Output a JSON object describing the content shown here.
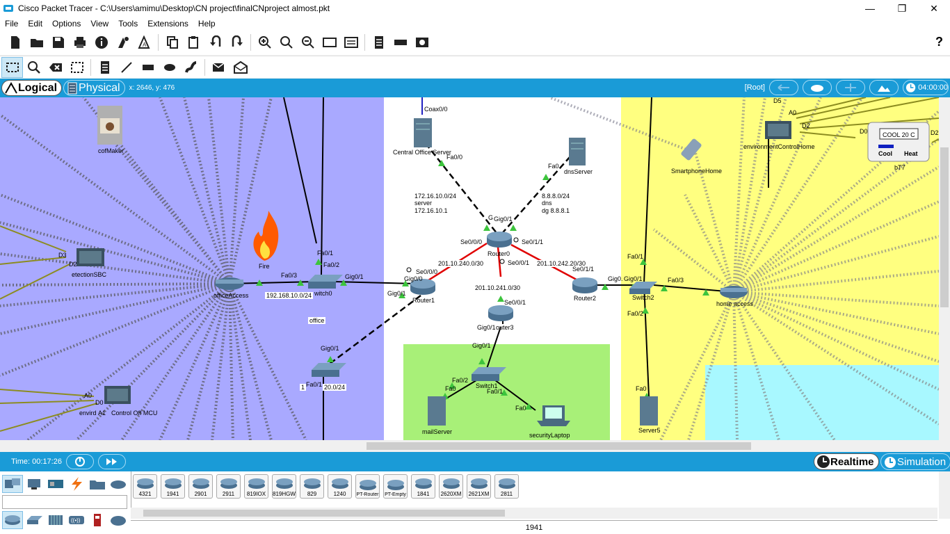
{
  "window": {
    "title": "Cisco Packet Tracer - C:\\Users\\amimu\\Desktop\\CN project\\finalCNproject almost.pkt",
    "minimize": "—",
    "maximize": "❐",
    "close": "✕"
  },
  "menu": [
    "File",
    "Edit",
    "Options",
    "View",
    "Tools",
    "Extensions",
    "Help"
  ],
  "toolbar": {
    "help": "?"
  },
  "modebar": {
    "logical": "Logical",
    "physical": "Physical",
    "coords": "x: 2646, y: 476",
    "root": "[Root]",
    "clock": "04:00:00"
  },
  "canvas": {
    "devices": {
      "cofmaker": "cofMaker",
      "fire": "Fire",
      "detection": "etectionSBC",
      "office_access": "officeAccess",
      "switch0": "witch0",
      "env_office": "envird",
      "control_office": "Control Off MCU",
      "central_server": "Central Office Server",
      "dns_server": "dnsServer",
      "router0": "Router0",
      "router1": "Router1",
      "router2": "Router2",
      "router3": "outer3",
      "switch1": "Switch1",
      "mail_server": "mailServer",
      "security_laptop": "securityLaptop",
      "smartphone": "SmartphoneHome",
      "env_home": "environmentControlHome",
      "thermostat": "bT7",
      "thermo_display": "COOL 20 C",
      "thermo_cool": "Cool",
      "thermo_heat": "Heat",
      "switch2": "Switch2",
      "home_access": "home access",
      "server5": "Server5"
    },
    "labels": {
      "coax": "Coax0/0",
      "fa00_central": "Fa0/0",
      "fa0_dns": "Fa0",
      "net_central": "172.16.10.0/24",
      "server_word": "server",
      "server_ip": "172.16.10.1",
      "net_dns": "8.8.8.0/24",
      "dns_word": "dns",
      "dns_dg": "dg 8.8.8.1",
      "g_partial": "G",
      "gig01_r0": "Gig0/1",
      "se000_r0": "Se0/0/0",
      "se011_r0": "Se0/1/1",
      "se001_r0": "Se0/0/1",
      "net_240": "201.10.240.0/30",
      "net_242": "201.10.242.20/30",
      "net_241": "201.10.241.0/30",
      "se000_r1": "Se0/0/0",
      "gig00_r1": "Gig0/0",
      "gig01_r1": "Gig0/1",
      "se011_r2": "Se0/1/1",
      "gig0_r2": "Gig0.",
      "gig01_sw2": "Gig0/1",
      "se001_r3": "Se0/0/1",
      "gig01_r3": "Gig0/1",
      "gig01_sw1": "Gig0/1",
      "fa02_sw1": "Fa0/2",
      "fa0_mail": "Fa0",
      "fa01_sw1": "Fa0/1",
      "fa0_laptop": "Fa0",
      "fa01_sw0": "Fa0/1",
      "fa02_sw0": "Fa0/2",
      "fa03_sw0": "Fa0/3",
      "gig01_sw0": "Gig0/1",
      "net_office": "192.168.10.0/24",
      "office": "office",
      "gig01_sw3": "Gig0/1",
      "fa01_sw3": "Fa0/1",
      "net_sw3": "20.0/24",
      "net_sw3_prefix": "1",
      "fa01_sw2": "Fa0/1",
      "fa03_sw2": "Fa0/3",
      "fa02_sw2": "Fa0/2",
      "fa0_s5": "Fa0",
      "d3": "D3",
      "d2": "D2",
      "a0": "A0",
      "d0": "D0",
      "a1": "A1",
      "d5": "D5",
      "a0h": "A0",
      "d2h": "D2",
      "d0t": "D0",
      "d2t": "D2"
    }
  },
  "timebar": {
    "time": "Time: 00:17:26",
    "realtime": "Realtime",
    "simulation": "Simulation"
  },
  "device_list": [
    "4321",
    "1941",
    "2901",
    "2911",
    "819IOX",
    "819HGW",
    "829",
    "1240",
    "PT-Router",
    "PT-Empty",
    "1841",
    "2620XM",
    "2621XM",
    "2811"
  ],
  "selected_model": "1941",
  "colors": {
    "office_zone": "#a9a9ff",
    "home_zone": "#ffff80",
    "mail_zone": "#a8f078",
    "pool_zone": "#a8f8ff",
    "accent": "#1a9bd7"
  }
}
